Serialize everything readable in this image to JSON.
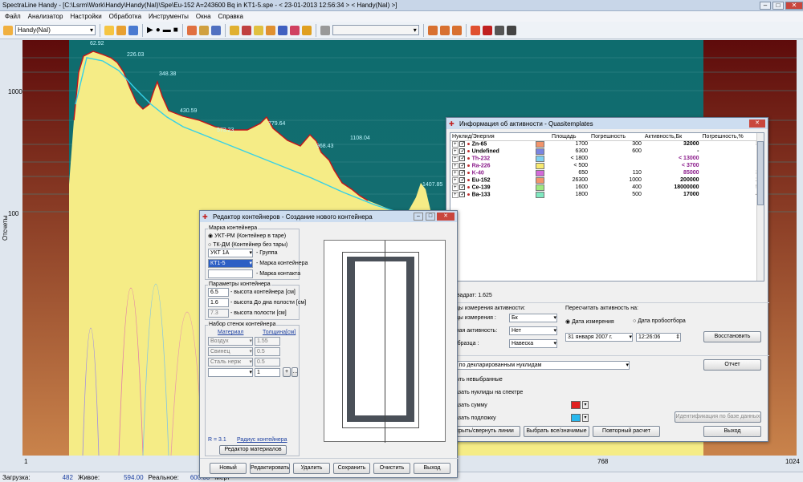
{
  "window": {
    "title": "SpectraLine Handy - [C:\\Lsrm\\Work\\Handy\\Handy(NaI)\\Spe\\Eu-152  A=243600 Bq  in KT1-5.spe - < 23-01-2013 12:56:34 > < Handy(NaI) >]"
  },
  "menu": [
    "Файл",
    "Анализатор",
    "Настройки",
    "Обработка",
    "Инструменты",
    "Окна",
    "Справка"
  ],
  "toolbar": {
    "detector": "Handy(NaI)"
  },
  "plot": {
    "ylabel": "Отсчеты",
    "yticks": [
      "1000",
      "100"
    ],
    "xticks": [
      "1",
      "768",
      "1024"
    ],
    "peaks": [
      "62.92",
      "226.03",
      "348.38",
      "430.59",
      "573.23",
      "779.64",
      "968.43",
      "1108.04",
      "1407.85"
    ]
  },
  "status": {
    "load_label": "Загрузка:",
    "load_value": "482",
    "live_label": "Живое:",
    "live_value": "594.00",
    "real_label": "Реальное:",
    "real_value": "600.00",
    "dead_label": "Мерт"
  },
  "container_dialog": {
    "title": "Редактор контейнеров - Создание нового контейнера",
    "brand_group": "Марка контейнера",
    "radio1": "УКТ-РМ (Контейнер в таре)",
    "radio2": "ТК-ДМ (Контейнер без тары)",
    "group_value": "УКТ 1А",
    "group_label": "- Группа",
    "brand_value": "КТ1-5",
    "brand_label": "- Марка контейнера",
    "contact_label": "- Марка контакта",
    "params_group": "Параметры контейнера",
    "p1_value": "6.5",
    "p1_label": "- высота контейнера [см]",
    "p2_value": "1.6",
    "p2_label": "- высота До дна полости [см]",
    "p3_value": "7.3",
    "p3_label": "- высота полости [см]",
    "walls_group": "Набор стенок контейнера",
    "col_material": "Материал",
    "col_thickness": "Толщина[см]",
    "walls": [
      {
        "m": "Воздух",
        "t": "1.55"
      },
      {
        "m": "Свинец",
        "t": "0.5"
      },
      {
        "m": "Сталь нерж",
        "t": "0.5"
      },
      {
        "m": "",
        "t": "1"
      }
    ],
    "radius_label": "R = 3.1",
    "radius_link": "Радиус контейнера",
    "materials_btn": "Редактор материалов",
    "buttons": [
      "Новый",
      "Редактировать",
      "Удалить",
      "Сохранить",
      "Очистить",
      "Выход"
    ]
  },
  "activity_dialog": {
    "title": "Информация об активности - Quasitemplates",
    "headers": [
      "Нуклид/Энергия",
      "",
      "Площадь",
      "Погрешность",
      "Активность,Бк",
      "Погрешность,%"
    ],
    "rows": [
      {
        "name": "Zn-65",
        "color": "#f2946b",
        "area": "1700",
        "err": "300",
        "act": "32000",
        "perr": "30",
        "red": false
      },
      {
        "name": "Undefined",
        "color": "#7a84e0",
        "area": "6300",
        "err": "600",
        "act": "-",
        "perr": "-",
        "red": false
      },
      {
        "name": "Th-232",
        "color": "#7fd0f0",
        "area": "< 1800",
        "err": "",
        "act": "< 13000",
        "perr": "",
        "red": true
      },
      {
        "name": "Ra-226",
        "color": "#f7e96e",
        "area": "< 500",
        "err": "",
        "act": "< 3700",
        "perr": "",
        "red": true
      },
      {
        "name": "K-40",
        "color": "#d36ad9",
        "area": "650",
        "err": "110",
        "act": "85000",
        "perr": "30",
        "red": true
      },
      {
        "name": "Eu-152",
        "color": "#f2946b",
        "area": "26300",
        "err": "1000",
        "act": "200000",
        "perr": "28",
        "red": false
      },
      {
        "name": "Ce-139",
        "color": "#9fe87f",
        "area": "1600",
        "err": "400",
        "act": "18000000",
        "perr": "50",
        "red": false
      },
      {
        "name": "Ba-133",
        "color": "#7fe8c0",
        "area": "1800",
        "err": "500",
        "act": "17000",
        "perr": "40",
        "red": false
      }
    ],
    "chi": "и квадрат: 1.625",
    "bounds_label": "ницы измерения активности:",
    "units_label": "ницы измерения :",
    "units_value": "Бк",
    "mda_label": "льная активность:",
    "mda_value": "Нет",
    "sample_label": "п образца :",
    "sample_value": "Навеска",
    "recalc_label": "Пересчитать активность на:",
    "radio_meas": "Дата измерения",
    "radio_sample": "Дата пробоотбора",
    "date_day": "31",
    "date_month": "января",
    "date_year": "2007 г.",
    "time": "12:26:06",
    "restore_btn": "Восстановить",
    "report_select": "ет по декларированным нуклидам",
    "report_btn": "Отчет",
    "opt1": "крыть невыбранные",
    "opt2": "оказать нуклиды на спектре",
    "opt3": "оказать сумму",
    "opt4": "оказать подложку",
    "ident_btn": "Идентификация по базе данных",
    "b1": "крыть/свернуть линии",
    "b2": "Выбрать все/значимые",
    "b3": "Повторный расчет",
    "exit_btn": "Выход"
  }
}
